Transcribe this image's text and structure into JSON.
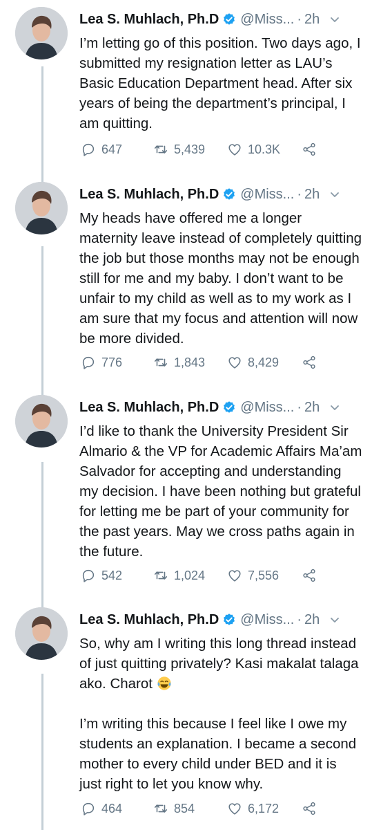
{
  "colors": {
    "text": "#14171a",
    "secondary": "#657786",
    "verified": "#1da1f2",
    "thread_line": "#c4cfd6"
  },
  "tweets": [
    {
      "name": "Lea S. Muhlach, Ph.D",
      "handle": "@Miss...",
      "time": "2h",
      "text": "I’m letting go of this position. Two days ago, I submitted my resignation letter as LAU’s Basic Education Department head. After six years of being the department’s principal, I am quitting.",
      "replies": "647",
      "retweets": "5,439",
      "likes": "10.3K"
    },
    {
      "name": "Lea S. Muhlach, Ph.D",
      "handle": "@Miss...",
      "time": "2h",
      "text": "My heads have offered me a longer maternity leave instead of completely quitting the job but those months may not be enough still for me and my baby. I don’t want to be unfair to my child as well as to my work as I am sure that my focus and attention will now be more divided.",
      "replies": "776",
      "retweets": "1,843",
      "likes": "8,429"
    },
    {
      "name": "Lea S. Muhlach, Ph.D",
      "handle": "@Miss...",
      "time": "2h",
      "text": "I’d like to thank the University President Sir Almario & the VP for Academic Affairs Ma’am Salvador for accepting and understanding my decision. I have been nothing but grateful for letting me be part of your community for the past years. May we cross paths again in the future.",
      "replies": "542",
      "retweets": "1,024",
      "likes": "7,556"
    },
    {
      "name": "Lea S. Muhlach, Ph.D",
      "handle": "@Miss...",
      "time": "2h",
      "text_a": "So, why am I writing this long thread instead of just quitting privately? Kasi makalat talaga ako. Charot",
      "emoji": "face-with-tears-of-joy",
      "text_b": "I’m writing this because I feel like I owe my students an explanation. I became a second mother to every child under BED and it is just right to let you know why.",
      "replies": "464",
      "retweets": "854",
      "likes": "6,172"
    }
  ]
}
